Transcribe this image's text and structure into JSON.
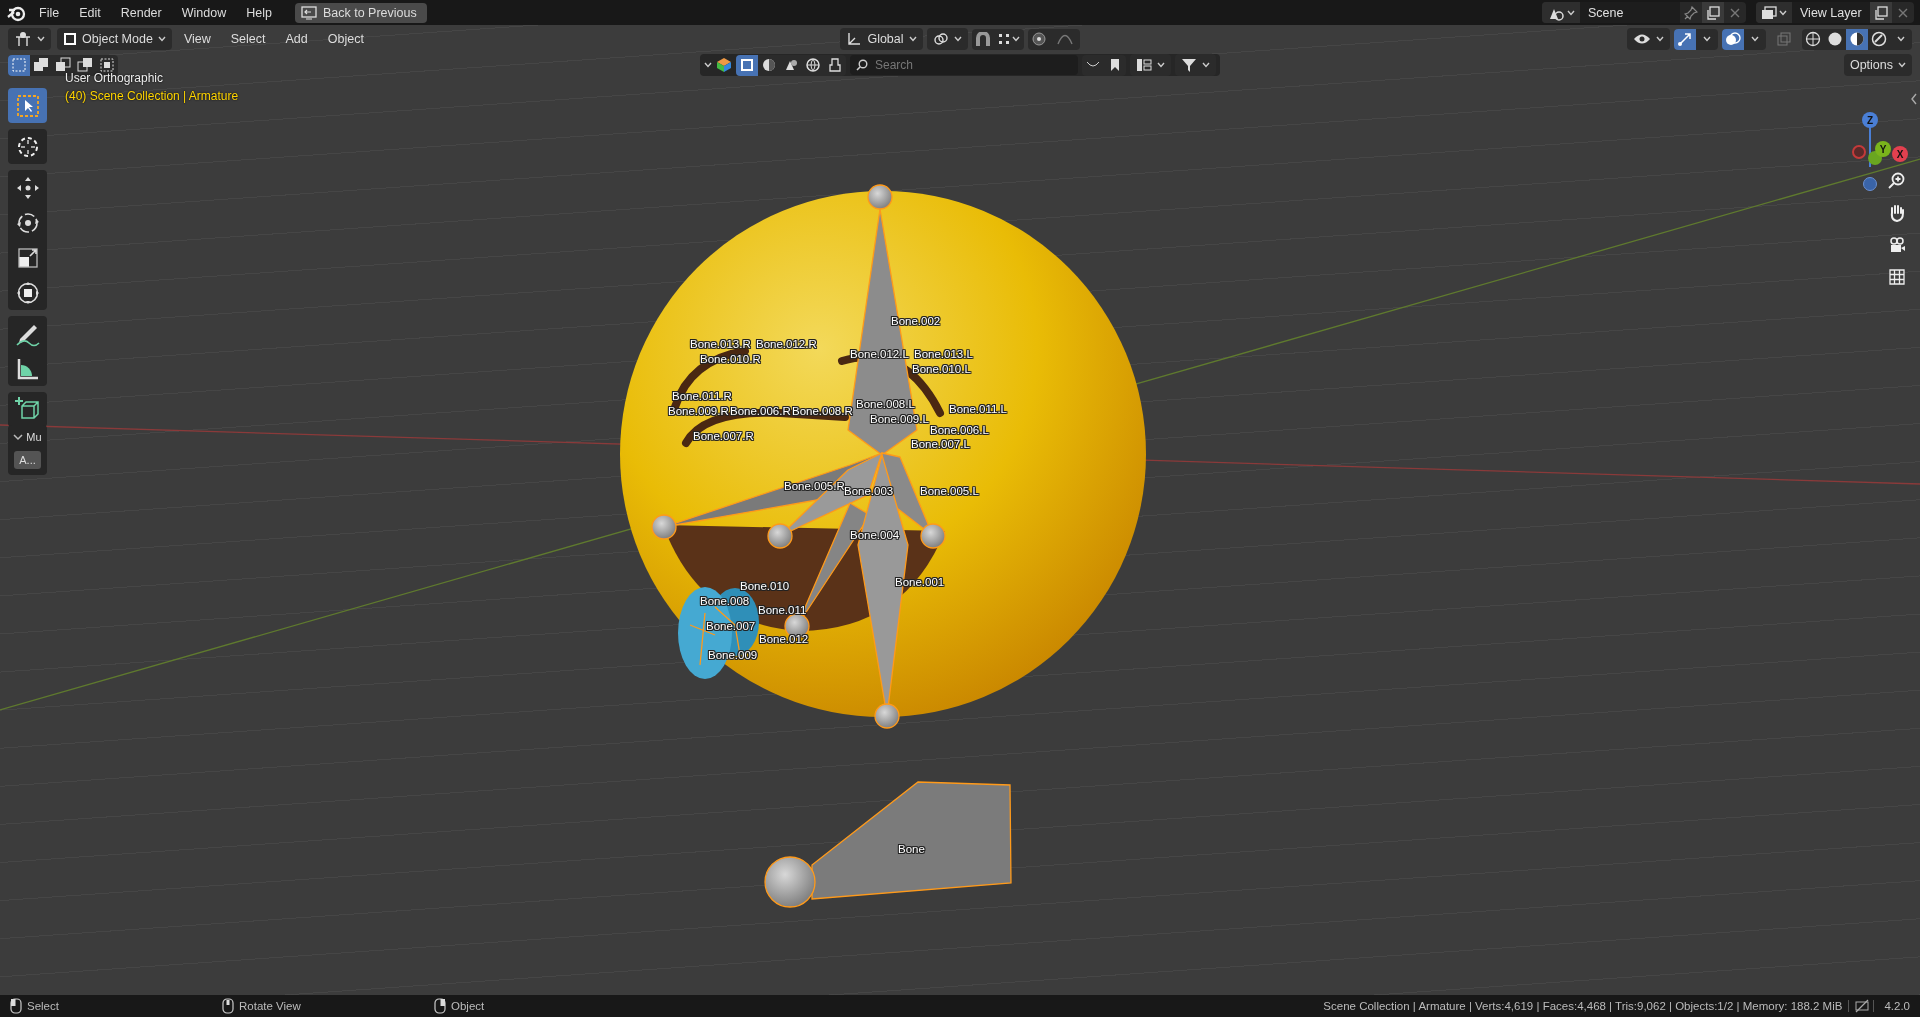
{
  "top_bar": {
    "menus": [
      "File",
      "Edit",
      "Render",
      "Window",
      "Help"
    ],
    "back_button": "Back to Previous",
    "scene": "Scene",
    "view_layer": "View Layer"
  },
  "header": {
    "mode": "Object Mode",
    "menus": [
      "View",
      "Select",
      "Add",
      "Object"
    ],
    "orientation": "Global"
  },
  "select_modes": [
    {
      "kind": "new",
      "selected": true
    },
    {
      "kind": "extend",
      "selected": false
    },
    {
      "kind": "subtract",
      "selected": false
    },
    {
      "kind": "invert",
      "selected": false
    },
    {
      "kind": "intersect",
      "selected": false
    }
  ],
  "filters": [
    {
      "kind": "object",
      "selected": true
    },
    {
      "kind": "shading",
      "selected": false
    },
    {
      "kind": "geometry",
      "selected": false
    },
    {
      "kind": "world",
      "selected": false
    },
    {
      "kind": "paint",
      "selected": false
    }
  ],
  "search": {
    "placeholder": "Search"
  },
  "shading_modes": [
    {
      "kind": "wireframe",
      "selected": false
    },
    {
      "kind": "solid",
      "selected": false
    },
    {
      "kind": "material",
      "selected": true
    },
    {
      "kind": "rendered",
      "selected": false
    }
  ],
  "options_button": "Options",
  "overlay": {
    "view": "User Orthographic",
    "context": "(40) Scene Collection | Armature"
  },
  "tools": [
    {
      "kind": "select-box",
      "selected": true
    },
    {
      "kind": "cursor",
      "selected": false
    },
    {
      "kind": "move",
      "selected": false
    },
    {
      "kind": "rotate",
      "selected": false
    },
    {
      "kind": "scale",
      "selected": false
    },
    {
      "kind": "transform",
      "selected": false
    },
    {
      "kind": "annotate",
      "selected": false
    },
    {
      "kind": "measure",
      "selected": false
    },
    {
      "kind": "add-cube",
      "selected": false
    }
  ],
  "side_panel": {
    "heading": "Mu",
    "expanded": true,
    "button": "A..."
  },
  "gizmo": {
    "axes": [
      "Z",
      "Y",
      "X"
    ]
  },
  "bone_labels": [
    "Bone.002",
    "Bone.013.R",
    "Bone.010.R",
    "Bone.012.R",
    "Bone.012.L",
    "Bone.013.L",
    "Bone.010.L",
    "Bone.011.R",
    "Bone.009.R",
    "Bone.006.R",
    "Bone.008.R",
    "Bone.008.L",
    "Bone.009.L",
    "Bone.011.L",
    "Bone.006.L",
    "Bone.007.R",
    "Bone.007.L",
    "Bone.005.R",
    "Bone.003",
    "Bone.005.L",
    "Bone.004",
    "Bone.001",
    "Bone.010",
    "Bone.008",
    "Bone.011",
    "Bone.007",
    "Bone.012",
    "Bone.009",
    "Bone"
  ],
  "status_bar": {
    "hints": [
      {
        "kind": "left-click",
        "label": "Select"
      },
      {
        "kind": "middle-click",
        "label": "Rotate View"
      },
      {
        "kind": "right-click",
        "label": "Object"
      }
    ],
    "stats": "Scene Collection | Armature | Verts:4,619 | Faces:4,468 | Tris:9,062 | Objects:1/2 | Memory: 188.2 MiB",
    "version": "4.2.0"
  }
}
